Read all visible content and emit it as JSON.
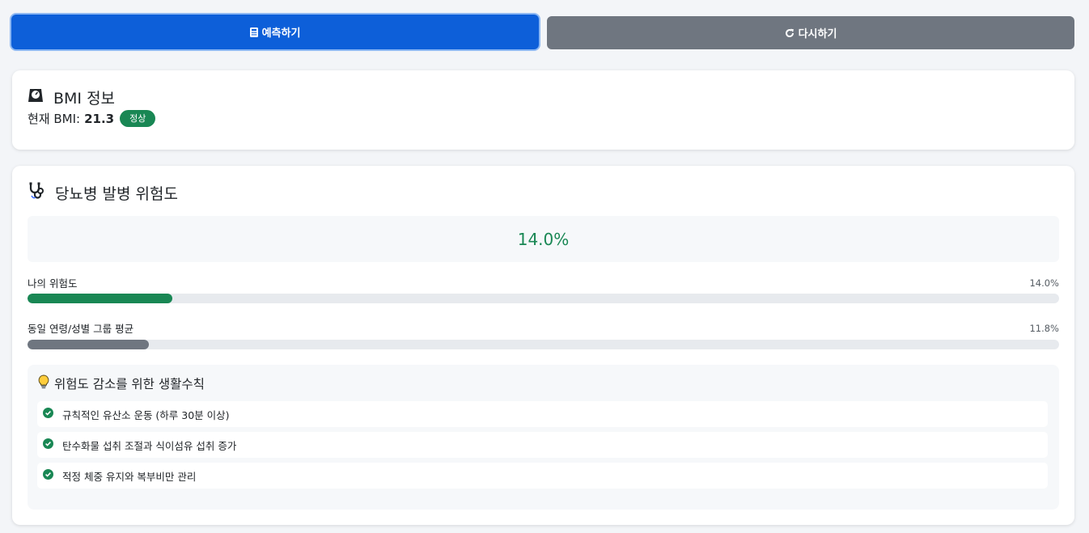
{
  "buttons": {
    "predict_label": "예측하기",
    "reset_label": "다시하기"
  },
  "bmi": {
    "title": "BMI 정보",
    "current_label": "현재 BMI:",
    "value": "21.3",
    "status": "정상"
  },
  "risk": {
    "title": "당뇨병 발병 위험도",
    "value_text": "14.0%",
    "mine": {
      "label": "나의 위험도",
      "pct_text": "14.0%",
      "percent": 14.0
    },
    "group": {
      "label": "동일 연령/성별 그룹 평균",
      "pct_text": "11.8%",
      "percent": 11.8
    }
  },
  "tips": {
    "title": "위험도 감소를 위한 생활수칙",
    "items": [
      "규칙적인 유산소 운동 (하루 30분 이상)",
      "탄수화물 섭취 조절과 식이섬유 섭취 증가",
      "적정 체중 유지와 복부비만 관리"
    ]
  },
  "colors": {
    "primary": "#0d5fd9",
    "secondary": "#6f7680",
    "success": "#198754",
    "group_bar": "#6f7680"
  },
  "icons": {
    "predict": "calculator-icon",
    "reset": "rotate-icon",
    "bmi": "weight-scale-icon",
    "risk": "stethoscope-icon",
    "tips": "lightbulb-icon",
    "tip_item": "check-circle-icon"
  }
}
